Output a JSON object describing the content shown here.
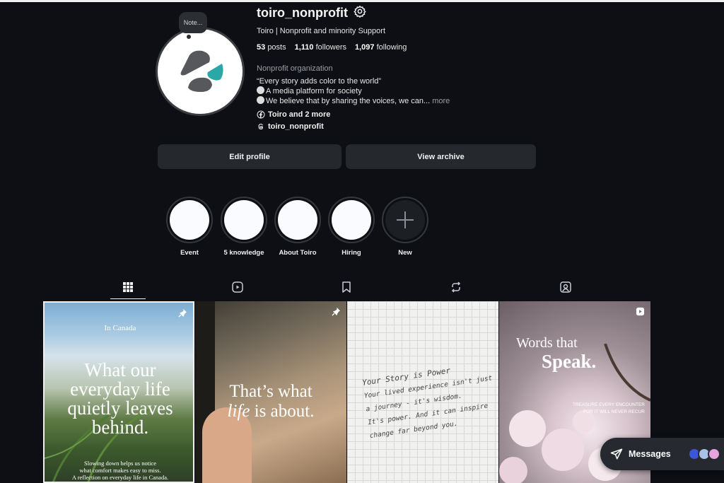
{
  "profile": {
    "note": "Note...",
    "username": "toiro_nonprofit",
    "full_name": "Toiro | Nonprofit and minority Support",
    "posts_count": "53",
    "posts_label": "posts",
    "followers_count": "1,110",
    "followers_label": "followers",
    "following_count": "1,097",
    "following_label": "following",
    "category": "Nonprofit organization",
    "bio_line1": "“Every story adds color to the world”",
    "bio_line2": "A media platform for society",
    "bio_line3": "We believe that by sharing the voices, we can...",
    "bio_more": "more",
    "link_facebook": "Toiro and 2 more",
    "link_threads": "toiro_nonprofit"
  },
  "actions": {
    "edit_profile": "Edit profile",
    "view_archive": "View archive"
  },
  "highlights": [
    {
      "label": "Event"
    },
    {
      "label": "5 knowledge"
    },
    {
      "label": "About Toiro"
    },
    {
      "label": "Hiring"
    },
    {
      "label": "New"
    }
  ],
  "tabs": [
    {
      "icon": "grid-icon",
      "active": true
    },
    {
      "icon": "reels-icon",
      "active": false
    },
    {
      "icon": "bookmark-icon",
      "active": false
    },
    {
      "icon": "repost-icon",
      "active": false
    },
    {
      "icon": "tagged-icon",
      "active": false
    }
  ],
  "posts": [
    {
      "top": "In Canada",
      "title1": "What our",
      "title2": "everyday life",
      "title3": "quietly leaves",
      "title4": "behind.",
      "foot1": "Slowing down helps us notice",
      "foot2": "what comfort makes easy to miss.",
      "foot3": "A reflection on everyday life in Canada.",
      "pinned": true
    },
    {
      "title1": "That’s what",
      "title2_italic": "life",
      "title2_rest": " is about.",
      "pinned": true
    },
    {
      "hand1": "Your Story is Power",
      "hand2": "Your lived experience isn't just",
      "hand3": "a journey - it's wisdom.",
      "hand4": "It's power. And it can inspire",
      "hand5": "change far beyond you."
    },
    {
      "title1": "Words that",
      "title2": "Speak.",
      "sub1": "TREASURE EVERY ENCOUNTER",
      "sub2": "FOR IT WILL NEVER RECUR",
      "reel": true
    }
  ],
  "messages": {
    "label": "Messages"
  },
  "colors": {
    "background": "#0d0f14",
    "button": "#25292e",
    "accent_teal": "#2aa8a8"
  }
}
